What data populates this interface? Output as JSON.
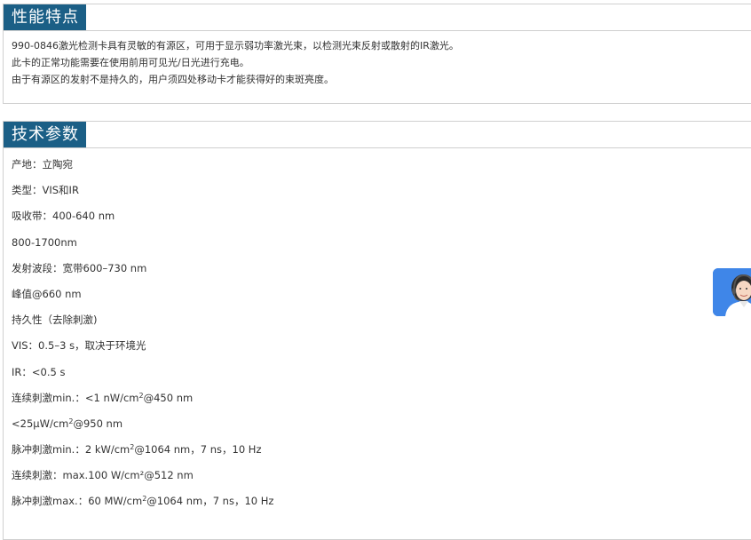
{
  "features": {
    "title": "性能特点",
    "lines": [
      "990-0846激光检测卡具有灵敏的有源区，可用于显示弱功率激光束，以检测光束反射或散射的IR激光。",
      "此卡的正常功能需要在使用前用可见光/日光进行充电。",
      "由于有源区的发射不是持久的，用户须四处移动卡才能获得好的束斑亮度。"
    ]
  },
  "specs": {
    "title": "技术参数",
    "items": [
      "产地：立陶宛",
      "类型：VIS和IR",
      "吸收带：400-640 nm",
      "800-1700nm",
      "发射波段：宽带600–730 nm",
      "峰值@660 nm",
      "持久性（去除刺激)",
      "VIS：0.5–3 s，取决于环境光",
      "IR：<0.5 s",
      {
        "pre": "连续刺激min.：<1 nW/cm",
        "sup": "2",
        "post": "@450 nm"
      },
      {
        "pre": "<25μW/cm",
        "sup": "2",
        "post": "@950 nm"
      },
      {
        "pre": "脉冲刺激min.：2 kW/cm",
        "sup": "2",
        "post": "@1064 nm，7 ns，10 Hz"
      },
      "连续刺激：max.100 W/cm²@512 nm",
      {
        "pre": "脉冲刺激max.：60 MW/cm",
        "sup": "2",
        "post": "@1064 nm，7 ns，10 Hz"
      }
    ]
  },
  "floating_widget": {
    "icon": "customer-service-icon",
    "color": "#3f86e8"
  }
}
